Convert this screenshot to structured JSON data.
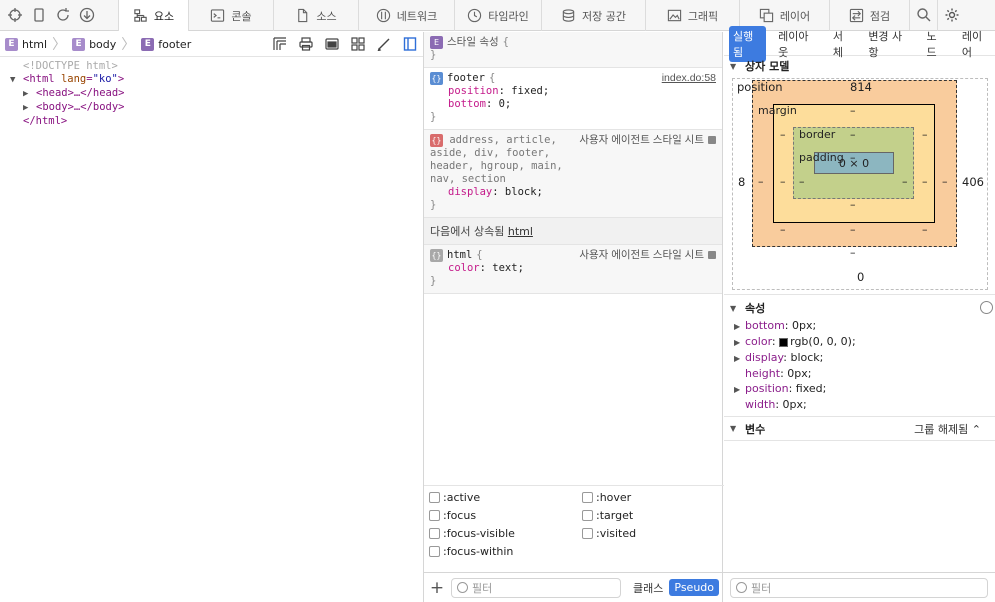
{
  "toolbar": {
    "tabs": [
      {
        "label": "요소",
        "icon": "elements-icon",
        "active": true
      },
      {
        "label": "콘솔",
        "icon": "console-icon"
      },
      {
        "label": "소스",
        "icon": "sources-icon"
      },
      {
        "label": "네트워크",
        "icon": "network-icon"
      },
      {
        "label": "타임라인",
        "icon": "timeline-icon"
      },
      {
        "label": "저장 공간",
        "icon": "storage-icon"
      },
      {
        "label": "그래픽",
        "icon": "graphics-icon"
      },
      {
        "label": "레이어",
        "icon": "layers-icon"
      },
      {
        "label": "점검",
        "icon": "audit-icon"
      }
    ]
  },
  "breadcrumb": [
    "html",
    "body",
    "footer"
  ],
  "dom_tree": {
    "doctype": "<!DOCTYPE html>",
    "html_open_tag": "html",
    "html_attr_name": "lang",
    "html_attr_value": "\"ko\"",
    "head": "<head>…</head>",
    "body": "<body>…</body>",
    "html_close": "</html>"
  },
  "styles": {
    "inline_label": "스타일 속성",
    "rules": [
      {
        "selector": "footer",
        "source": "index.do:58",
        "props": [
          {
            "name": "position",
            "value": "fixed"
          },
          {
            "name": "bottom",
            "value": "0"
          }
        ]
      },
      {
        "selector": "address, article, aside, div, footer, header, hgroup, main, nav, section",
        "source": "사용자 에이전트 스타일 시트",
        "props": [
          {
            "name": "display",
            "value": "block"
          }
        ]
      }
    ],
    "inherited_label": "다음에서 상속됨",
    "inherited_from": "html",
    "inherited_rule": {
      "selector": "html",
      "source": "사용자 에이전트 스타일 시트",
      "props": [
        {
          "name": "color",
          "value": "text"
        }
      ]
    }
  },
  "pseudo_classes": [
    ":active",
    ":hover",
    ":focus",
    ":target",
    ":focus-visible",
    ":visited",
    ":focus-within"
  ],
  "mid_filter": {
    "placeholder": "필터",
    "class_label": "클래스",
    "pseudo_label": "Pseudo"
  },
  "right_tabs": [
    "실행됨",
    "레이아웃",
    "서체",
    "변경 사항",
    "노드",
    "레이어"
  ],
  "box_model": {
    "title": "상자 모델",
    "position_label": "position",
    "position_top": "814",
    "position_left": "8",
    "position_right": "406",
    "position_bottom": "0",
    "margin_label": "margin",
    "border_label": "border",
    "padding_label": "padding",
    "content": "0 × 0",
    "dash": "–"
  },
  "computed": {
    "title": "속성",
    "props": [
      {
        "name": "bottom",
        "value": "0px",
        "expandable": true
      },
      {
        "name": "color",
        "value": "rgb(0, 0, 0)",
        "expandable": true,
        "swatch": "#000000"
      },
      {
        "name": "display",
        "value": "block",
        "expandable": true
      },
      {
        "name": "height",
        "value": "0px",
        "expandable": false
      },
      {
        "name": "position",
        "value": "fixed",
        "expandable": true
      },
      {
        "name": "width",
        "value": "0px",
        "expandable": false
      }
    ]
  },
  "variables": {
    "title": "변수",
    "group_label": "그룹 해제됨"
  },
  "right_filter": {
    "placeholder": "필터"
  },
  "colors": {
    "accent": "#3d7be0",
    "margin": "#f9cc9d",
    "border": "#fddd9b",
    "padding": "#c3d08b",
    "content": "#8cb6c0"
  }
}
